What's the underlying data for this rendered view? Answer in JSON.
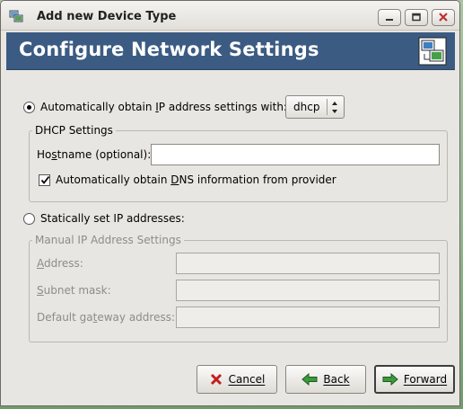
{
  "window": {
    "title": "Add new Device Type",
    "banner_title": "Configure Network Settings"
  },
  "auto": {
    "label_pre": "Automatically obtain ",
    "label_key": "I",
    "label_post": "P address settings with:",
    "checked": true,
    "method": "dhcp"
  },
  "dhcp": {
    "legend": "DHCP Settings",
    "hostname_label_pre": "Ho",
    "hostname_label_key": "s",
    "hostname_label_post": "tname (optional):",
    "hostname_value": "",
    "dns_label_pre": "Automatically obtain ",
    "dns_label_key": "D",
    "dns_label_post": "NS information from provider",
    "dns_checked": true
  },
  "static": {
    "label": "Statically set IP addresses:",
    "checked": false
  },
  "manual": {
    "legend": "Manual IP Address Settings",
    "address_label_key": "A",
    "address_label_post": "ddress:",
    "address_value": "",
    "subnet_label_key": "S",
    "subnet_label_post": "ubnet mask:",
    "subnet_value": "",
    "gateway_label_pre": "Default ga",
    "gateway_label_key": "t",
    "gateway_label_post": "eway address:",
    "gateway_value": ""
  },
  "buttons": {
    "cancel_key": "C",
    "cancel_post": "ancel",
    "back_key": "B",
    "back_post": "ack",
    "forward_key": "F",
    "forward_post": "orward"
  },
  "icons": {
    "app": "network-app-icon",
    "banner": "network-computers-icon",
    "cancel": "red-x-icon",
    "back": "left-arrow-icon",
    "forward": "right-arrow-icon"
  }
}
